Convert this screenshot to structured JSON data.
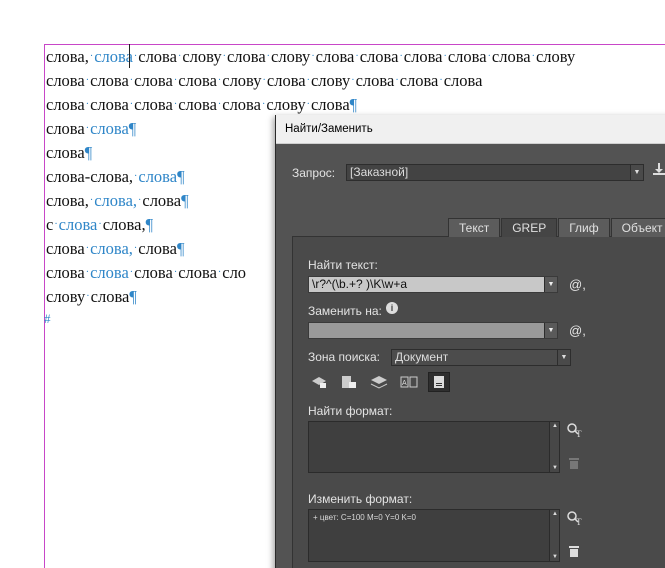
{
  "document": {
    "lines": [
      {
        "words": [
          {
            "t": "слова,",
            "hl": false
          },
          {
            "t": "слова",
            "hl": true
          },
          {
            "t": "слова",
            "hl": false
          },
          {
            "t": "слову",
            "hl": false
          },
          {
            "t": "слова",
            "hl": false
          },
          {
            "t": "слову",
            "hl": false
          },
          {
            "t": "слова",
            "hl": false
          },
          {
            "t": "слова",
            "hl": false
          },
          {
            "t": "слова",
            "hl": false
          },
          {
            "t": "слова",
            "hl": false
          },
          {
            "t": "слова",
            "hl": false
          },
          {
            "t": "слову",
            "hl": false
          }
        ],
        "end": ""
      },
      {
        "words": [
          {
            "t": "слова",
            "hl": false
          },
          {
            "t": "слова",
            "hl": false
          },
          {
            "t": "слова",
            "hl": false
          },
          {
            "t": "слова",
            "hl": false
          },
          {
            "t": "слову",
            "hl": false
          },
          {
            "t": "слова",
            "hl": false
          },
          {
            "t": "слову",
            "hl": false
          },
          {
            "t": "слова",
            "hl": false
          },
          {
            "t": "слова",
            "hl": false
          },
          {
            "t": "слова",
            "hl": false
          }
        ],
        "end": ""
      },
      {
        "words": [
          {
            "t": "слова",
            "hl": false
          },
          {
            "t": "слова",
            "hl": false
          },
          {
            "t": "слова",
            "hl": false
          },
          {
            "t": "слова",
            "hl": false
          },
          {
            "t": "слова",
            "hl": false
          },
          {
            "t": "слову",
            "hl": false
          },
          {
            "t": "слова",
            "hl": false
          }
        ],
        "end": "¶"
      },
      {
        "words": [
          {
            "t": "слова",
            "hl": false
          },
          {
            "t": "слова",
            "hl": true
          }
        ],
        "end": "¶"
      },
      {
        "words": [
          {
            "t": "слова",
            "hl": false
          }
        ],
        "end": "¶"
      },
      {
        "words": [
          {
            "t": "слова-слова,",
            "hl": false
          },
          {
            "t": "слова",
            "hl": true
          }
        ],
        "end": "¶"
      },
      {
        "words": [
          {
            "t": "слова,",
            "hl": false
          },
          {
            "t": "слова,",
            "hl": true
          },
          {
            "t": "слова",
            "hl": false
          }
        ],
        "end": "¶"
      },
      {
        "words": [
          {
            "t": "с",
            "hl": false
          },
          {
            "t": "слова",
            "hl": true
          },
          {
            "t": "слова,",
            "hl": false
          }
        ],
        "end": "¶"
      },
      {
        "words": [
          {
            "t": "слова",
            "hl": false
          },
          {
            "t": "слова,",
            "hl": true
          },
          {
            "t": "слова",
            "hl": false
          }
        ],
        "end": "¶"
      },
      {
        "words": [
          {
            "t": "слова",
            "hl": false
          },
          {
            "t": "слова",
            "hl": true
          },
          {
            "t": "слова",
            "hl": false
          },
          {
            "t": "слова",
            "hl": false
          },
          {
            "t": "сло",
            "hl": false
          }
        ],
        "end": ""
      },
      {
        "words": [
          {
            "t": "слову",
            "hl": false
          },
          {
            "t": "слова",
            "hl": false
          }
        ],
        "end": "¶"
      }
    ],
    "end_marker": "#"
  },
  "dialog": {
    "title": "Найти/Заменить",
    "query_label": "Запрос:",
    "query_value": "[Заказной]",
    "tabs": [
      "Текст",
      "GREP",
      "Глиф",
      "Объект"
    ],
    "active_tab": 1,
    "find_label": "Найти текст:",
    "find_value": "\\r?^(\\b.+? )\\K\\w+a",
    "replace_label": "Заменить на:",
    "replace_value": "",
    "special_chars_symbol": "@,",
    "info_symbol": "i",
    "search_label": "Зона поиска:",
    "search_value": "Документ",
    "find_format_label": "Найти формат:",
    "find_format_value": "",
    "change_format_label": "Изменить формат:",
    "change_format_value": "+ цвет: C=100 M=0 Y=0 K=0"
  },
  "colors": {
    "highlight": "#2f86c8",
    "frame_guide": "#c846c8",
    "dialog_bg": "#535353"
  }
}
